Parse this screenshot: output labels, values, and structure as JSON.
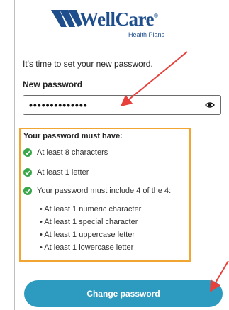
{
  "logo": {
    "name": "WellCare",
    "subtitle": "Health Plans",
    "icon": "wellcare-swoosh-logo",
    "color": "#1f4e8c"
  },
  "intro_text": "It's time to set your new password.",
  "password": {
    "label": "New password",
    "value": "••••••••••••••",
    "reveal_icon": "eye-icon"
  },
  "requirements": {
    "title": "Your password must have:",
    "items": [
      "At least 8 characters",
      "At least 1 letter",
      "Your password must include 4 of the 4:"
    ],
    "sub_items": [
      "• At least 1 numeric character",
      "• At least 1 special character",
      "• At least 1 uppercase letter",
      "• At least 1 lowercase letter"
    ],
    "check_color": "#3aa64a",
    "highlight_color": "#f0a630"
  },
  "submit": {
    "label": "Change password",
    "color": "#2d9bc0"
  },
  "annotations": {
    "arrow_color": "#e8413c"
  }
}
